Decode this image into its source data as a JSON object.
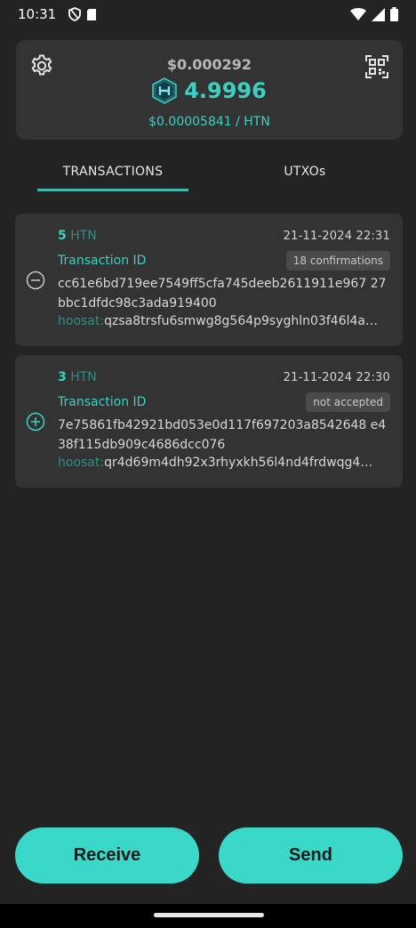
{
  "status_bar": {
    "time": "10:31"
  },
  "balance": {
    "usd_total": "$0.000292",
    "amount": "4.9996",
    "price": "$0.00005841 / HTN"
  },
  "tabs": [
    {
      "label": "TRANSACTIONS",
      "active": true
    },
    {
      "label": "UTXOs",
      "active": false
    }
  ],
  "transactions": [
    {
      "amount": "5",
      "unit": "HTN",
      "date": "21-11-2024 22:31",
      "id_label": "Transaction ID",
      "badge": "18 confirmations",
      "hash": "cc61e6bd719ee7549ff5cfa745deeb2611911e967 27bbc1dfdc98c3ada919400",
      "address_prefix": "hoosat:",
      "address": "qzsa8trsfu6smwg8g564p9syghln03f46l4a…",
      "direction": "out"
    },
    {
      "amount": "3",
      "unit": "HTN",
      "date": "21-11-2024 22:30",
      "id_label": "Transaction ID",
      "badge": "not accepted",
      "hash": "7e75861fb42921bd053e0d117f697203a8542648 e438f115db909c4686dcc076",
      "address_prefix": "hoosat:",
      "address": "qr4d69m4dh92x3rhyxkh56l4nd4frdwqg4…",
      "direction": "in"
    }
  ],
  "actions": {
    "receive_label": "Receive",
    "send_label": "Send"
  },
  "colors": {
    "accent": "#3ad2c3",
    "background": "#232323",
    "card": "#333333"
  }
}
